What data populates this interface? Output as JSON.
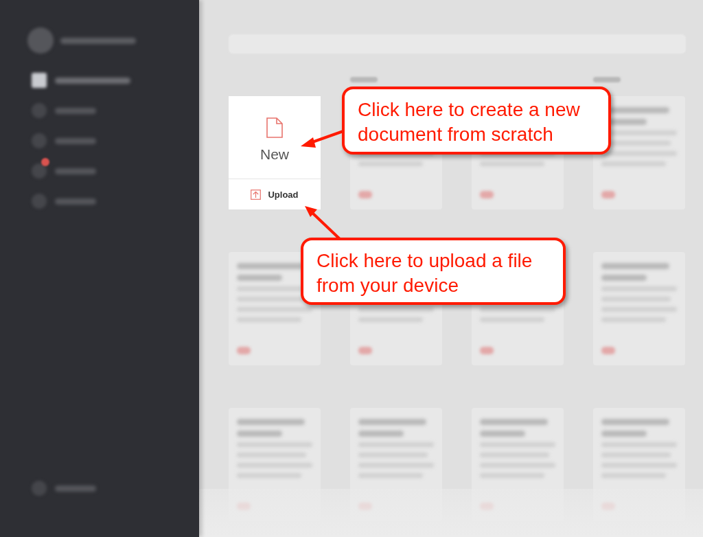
{
  "new_card": {
    "new_label": "New",
    "upload_label": "Upload"
  },
  "callouts": [
    {
      "text": "Click here to create a new document from scratch"
    },
    {
      "text": "Click here to upload a file from your device"
    }
  ]
}
